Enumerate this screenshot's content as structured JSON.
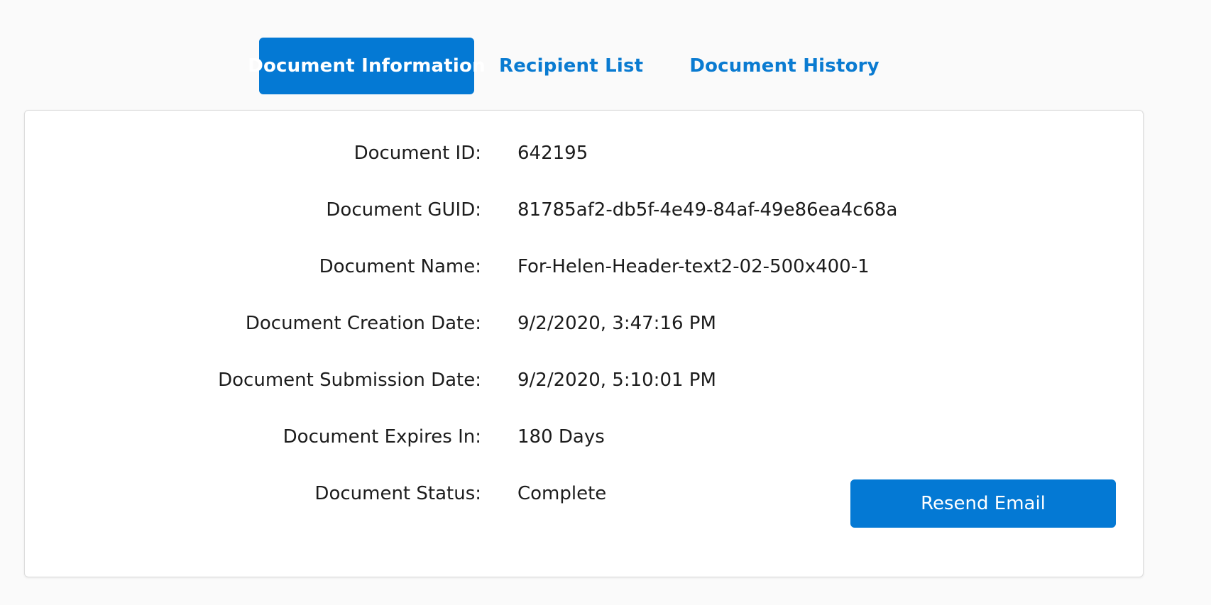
{
  "tabs": [
    {
      "label": "Document Information",
      "active": true
    },
    {
      "label": "Recipient List",
      "active": false
    },
    {
      "label": "Document History",
      "active": false
    }
  ],
  "fields": [
    {
      "label": "Document ID:",
      "value": "642195"
    },
    {
      "label": "Document GUID:",
      "value": "81785af2-db5f-4e49-84af-49e86ea4c68a"
    },
    {
      "label": "Document Name:",
      "value": "For-Helen-Header-text2-02-500x400-1"
    },
    {
      "label": "Document Creation Date:",
      "value": "9/2/2020, 3:47:16 PM"
    },
    {
      "label": "Document Submission Date:",
      "value": "9/2/2020, 5:10:01 PM"
    },
    {
      "label": "Document Expires In:",
      "value": "180 Days"
    },
    {
      "label": "Document Status:",
      "value": "Complete"
    }
  ],
  "actions": {
    "resend_label": "Resend Email"
  },
  "colors": {
    "accent": "#0479d4",
    "link": "#0a7bd1",
    "background": "#fafafa",
    "text": "#1c1c1c"
  }
}
